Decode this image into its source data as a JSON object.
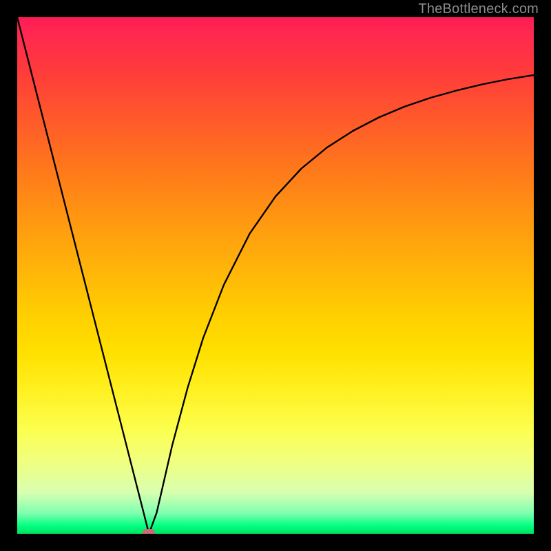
{
  "watermark": "TheBottleneck.com",
  "chart_data": {
    "type": "line",
    "title": "",
    "xlabel": "",
    "ylabel": "",
    "xlim": [
      0,
      100
    ],
    "ylim": [
      0,
      100
    ],
    "grid": false,
    "series": [
      {
        "name": "bottleneck-curve",
        "x": [
          0,
          5,
          10,
          15,
          20,
          25,
          25.5,
          27,
          30,
          33,
          36,
          40,
          45,
          50,
          55,
          60,
          65,
          70,
          75,
          80,
          85,
          90,
          95,
          100
        ],
        "values": [
          100,
          80.4,
          60.8,
          41.2,
          21.6,
          2.0,
          0.0,
          4.1,
          17.1,
          28.3,
          37.9,
          48.2,
          58.1,
          65.3,
          70.7,
          74.8,
          78.0,
          80.6,
          82.7,
          84.4,
          85.8,
          87.0,
          88.0,
          88.8
        ]
      }
    ],
    "marker": {
      "x": 25.5,
      "y": 0.3
    },
    "colors": {
      "gradient_top": "#ff1a55",
      "gradient_bottom": "#00e060",
      "curve": "#000000",
      "marker": "#cc6b72",
      "frame": "#000000"
    }
  }
}
